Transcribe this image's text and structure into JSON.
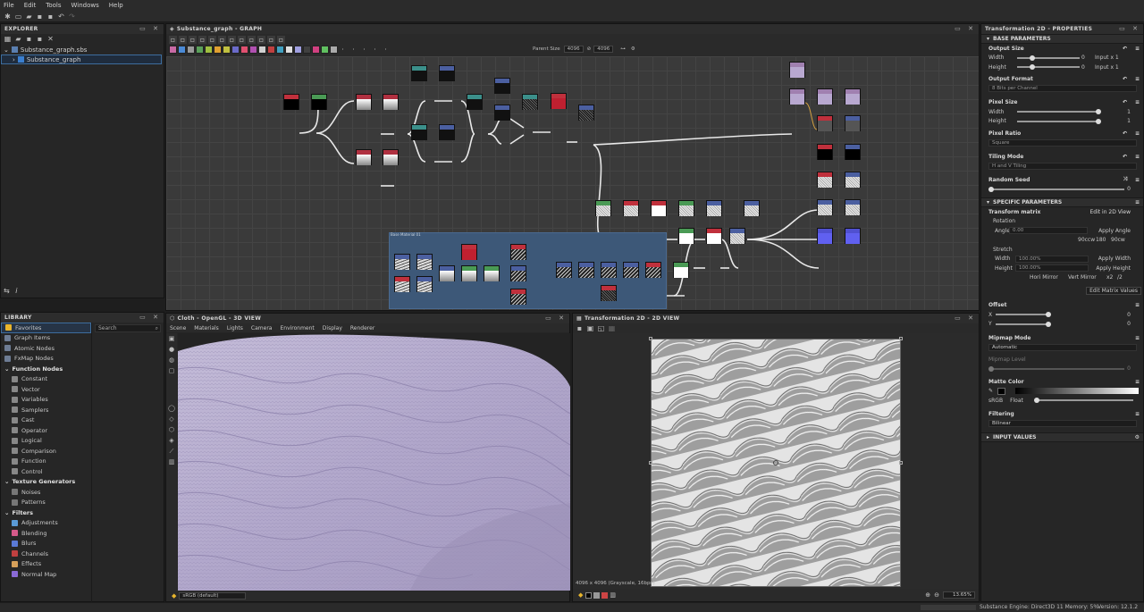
{
  "menu": [
    "File",
    "Edit",
    "Tools",
    "Windows",
    "Help"
  ],
  "explorer": {
    "title": "EXPLORER",
    "file": "Substance_graph.sbs",
    "graph": "Substance_graph"
  },
  "library": {
    "title": "LIBRARY",
    "search_placeholder": "Search",
    "items": [
      {
        "label": "Favorites",
        "color": "#e8b52c",
        "head": false,
        "sel": true
      },
      {
        "label": "Graph Items",
        "color": "#6e7d95",
        "head": false
      },
      {
        "label": "Atomic Nodes",
        "color": "#6e7d95",
        "head": false
      },
      {
        "label": "FxMap Nodes",
        "color": "#6e7d95",
        "head": false
      },
      {
        "label": "Function Nodes",
        "color": "",
        "head": true
      },
      {
        "label": "Constant",
        "color": "#888",
        "head": false
      },
      {
        "label": "Vector",
        "color": "#888",
        "head": false
      },
      {
        "label": "Variables",
        "color": "#888",
        "head": false
      },
      {
        "label": "Samplers",
        "color": "#888",
        "head": false
      },
      {
        "label": "Cast",
        "color": "#888",
        "head": false
      },
      {
        "label": "Operator",
        "color": "#888",
        "head": false
      },
      {
        "label": "Logical",
        "color": "#888",
        "head": false
      },
      {
        "label": "Comparison",
        "color": "#888",
        "head": false
      },
      {
        "label": "Function",
        "color": "#888",
        "head": false
      },
      {
        "label": "Control",
        "color": "#888",
        "head": false
      },
      {
        "label": "Texture Generators",
        "color": "",
        "head": true
      },
      {
        "label": "Noises",
        "color": "#777",
        "head": false
      },
      {
        "label": "Patterns",
        "color": "#777",
        "head": false
      },
      {
        "label": "Filters",
        "color": "",
        "head": true
      },
      {
        "label": "Adjustments",
        "color": "#5a9ad6",
        "head": false
      },
      {
        "label": "Blending",
        "color": "#d65a8a",
        "head": false
      },
      {
        "label": "Blurs",
        "color": "#5a7ad6",
        "head": false
      },
      {
        "label": "Channels",
        "color": "#c04040",
        "head": false
      },
      {
        "label": "Effects",
        "color": "#d6a05a",
        "head": false
      },
      {
        "label": "Normal Map",
        "color": "#8a6ad6",
        "head": false
      }
    ]
  },
  "graph": {
    "title": "Substance_graph - GRAPH",
    "parent_size_label": "Parent Size",
    "parent_size": "4096",
    "size2": "4096",
    "frame_label": "Base Material 01"
  },
  "view3d": {
    "title": "Cloth - OpenGL - 3D VIEW",
    "tabs": [
      "Scene",
      "Materials",
      "Lights",
      "Camera",
      "Environment",
      "Display",
      "Renderer"
    ],
    "colorspace": "sRGB (default)"
  },
  "view2d": {
    "title": "Transformation 2D - 2D VIEW",
    "info": "4096 x 4096 (Grayscale, 16bpc)",
    "zoom": "13.65%"
  },
  "properties": {
    "title": "Transformation 2D - PROPERTIES",
    "base_params": "BASE PARAMETERS",
    "output_size": "Output Size",
    "width": "Width",
    "height": "Height",
    "zero": "0",
    "input_x1": "Input x 1",
    "output_format": "Output Format",
    "output_format_val": "8 Bits per Channel",
    "pixel_size": "Pixel Size",
    "one": "1",
    "pixel_ratio": "Pixel Ratio",
    "pixel_ratio_val": "Square",
    "tiling_mode": "Tiling Mode",
    "tiling_val": "H and V Tiling",
    "random_seed": "Random Seed",
    "specific": "SPECIFIC PARAMETERS",
    "transform_matrix": "Transform matrix",
    "edit_in_2d": "Edit in 2D View",
    "rotation": "Rotation",
    "angle": "Angle",
    "angle_val": "0.00",
    "apply_angle": "Apply Angle",
    "deg90ccw": "90ccw",
    "deg180": "180",
    "deg90cw": "90cw",
    "stretch": "Stretch",
    "width_val": "100.00%",
    "height_val": "100.00%",
    "apply_width": "Apply Width",
    "apply_height": "Apply Height",
    "hori_mirror": "Hori Mirror",
    "vert_mirror": "Vert Mirror",
    "x2": "x2",
    "div2": "/2",
    "edit_matrix": "Edit Matrix Values",
    "offset": "Offset",
    "x": "X",
    "y": "Y",
    "mipmap_mode": "Mipmap Mode",
    "mipmap_val": "Automatic",
    "mipmap_level": "Mipmap Level",
    "matte_color": "Matte Color",
    "srgb": "sRGB",
    "float": "Float",
    "filtering": "Filtering",
    "filtering_val": "Bilinear",
    "input_values": "INPUT VALUES"
  },
  "status": {
    "engine": "Substance Engine: Direct3D 11 Memory: 5%",
    "version": "Version: 12.1.2"
  }
}
